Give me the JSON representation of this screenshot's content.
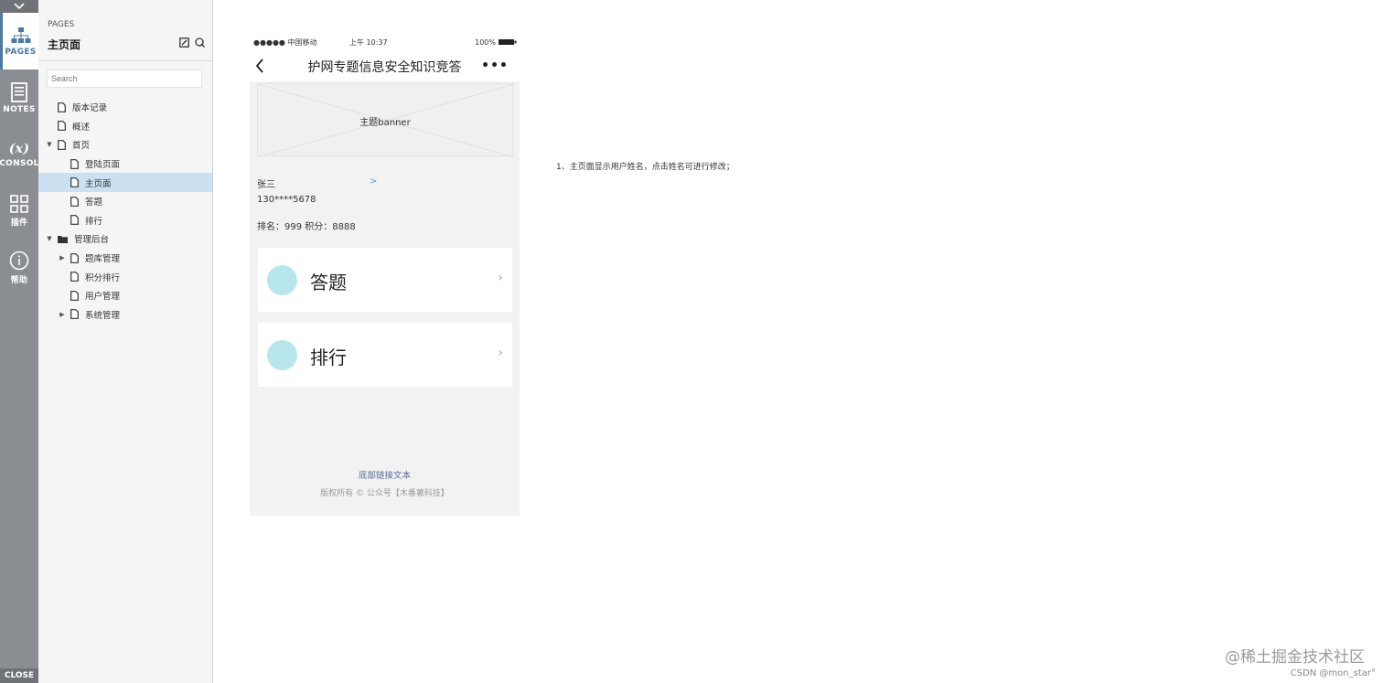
{
  "rail": {
    "items": [
      {
        "label": "PAGES",
        "icon": "sitemap-icon"
      },
      {
        "label": "NOTES",
        "icon": "notes-icon"
      },
      {
        "label": "CONSOL",
        "icon": "variable-icon"
      },
      {
        "label": "插件",
        "icon": "grid-icon"
      },
      {
        "label": "帮助",
        "icon": "info-icon"
      }
    ],
    "close_label": "CLOSE"
  },
  "pages_panel": {
    "section_label": "PAGES",
    "current_page": "主页面",
    "search_placeholder": "Search",
    "tree": [
      {
        "label": "版本记录"
      },
      {
        "label": "概述"
      },
      {
        "label": "首页"
      },
      {
        "label": "登陆页面"
      },
      {
        "label": "主页面"
      },
      {
        "label": "答题"
      },
      {
        "label": "排行"
      },
      {
        "label": "管理后台"
      },
      {
        "label": "题库管理"
      },
      {
        "label": "积分排行"
      },
      {
        "label": "用户管理"
      },
      {
        "label": "系统管理"
      }
    ]
  },
  "phone": {
    "status": {
      "signal": "●●●●● 中国移动",
      "time": "上午 10:37",
      "battery": "100%"
    },
    "title": "护网专题信息安全知识竞答",
    "banner_text": "主题banner",
    "user": {
      "name": "张三",
      "link": ">",
      "phone": "130****5678",
      "rank": "排名：999  积分：8888"
    },
    "cards": [
      {
        "label": "答题"
      },
      {
        "label": "排行"
      }
    ],
    "footer_link": "底部链接文本",
    "footer_copy": "版权所有 © 公众号【木番薯科技】"
  },
  "note": "1、主页面显示用户姓名，点击姓名可进行修改；",
  "watermark": "@稀土掘金技术社区",
  "credit": "CSDN @mon_star°"
}
